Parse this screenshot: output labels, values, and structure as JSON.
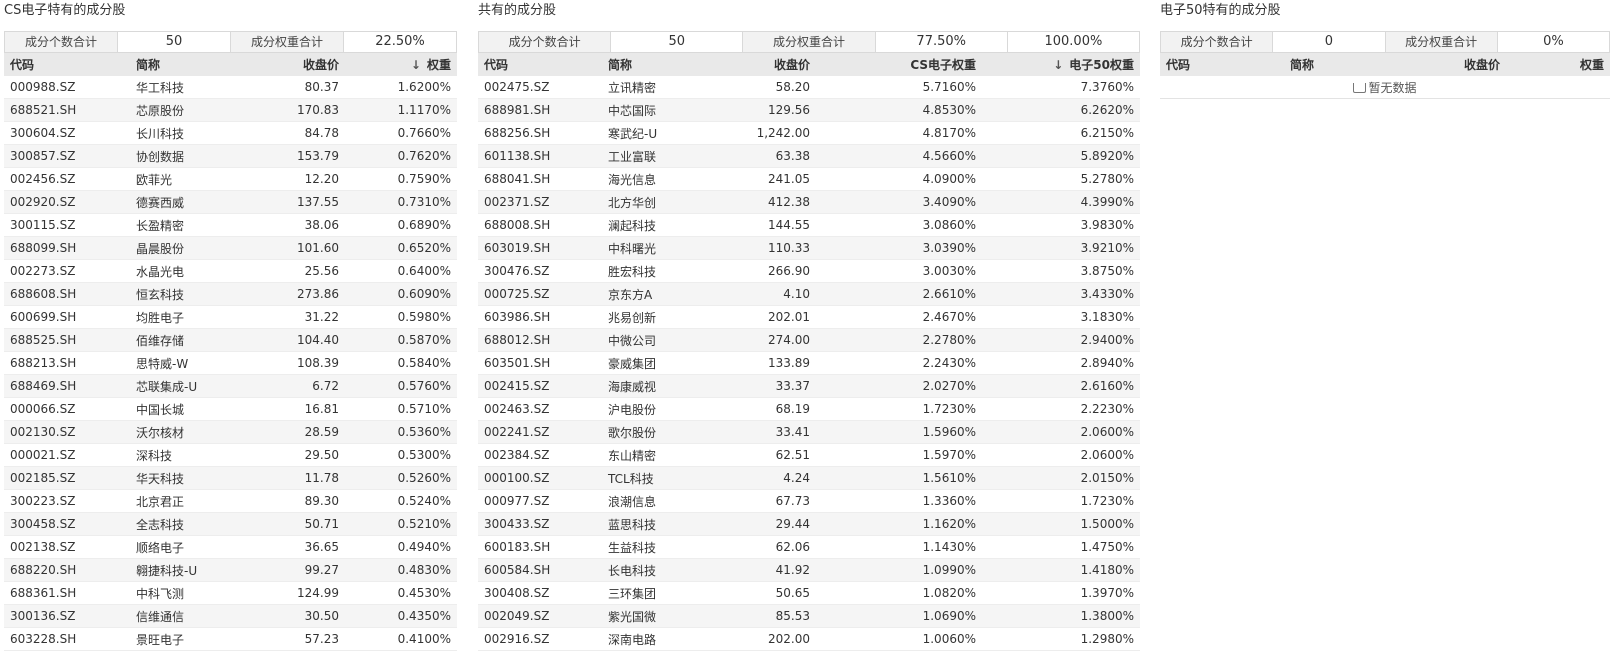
{
  "panel1": {
    "title": "CS电子特有的成分股",
    "summary": {
      "count_label": "成分个数合计",
      "count_value": "50",
      "weight_label": "成分权重合计",
      "weight_value": "22.50%"
    },
    "columns": [
      "代码",
      "简称",
      "收盘价",
      "权重"
    ],
    "sort_indicator": "↓",
    "rows": [
      [
        "000988.SZ",
        "华工科技",
        "80.37",
        "1.6200%"
      ],
      [
        "688521.SH",
        "芯原股份",
        "170.83",
        "1.1170%"
      ],
      [
        "300604.SZ",
        "长川科技",
        "84.78",
        "0.7660%"
      ],
      [
        "300857.SZ",
        "协创数据",
        "153.79",
        "0.7620%"
      ],
      [
        "002456.SZ",
        "欧菲光",
        "12.20",
        "0.7590%"
      ],
      [
        "002920.SZ",
        "德赛西威",
        "137.55",
        "0.7310%"
      ],
      [
        "300115.SZ",
        "长盈精密",
        "38.06",
        "0.6890%"
      ],
      [
        "688099.SH",
        "晶晨股份",
        "101.60",
        "0.6520%"
      ],
      [
        "002273.SZ",
        "水晶光电",
        "25.56",
        "0.6400%"
      ],
      [
        "688608.SH",
        "恒玄科技",
        "273.86",
        "0.6090%"
      ],
      [
        "600699.SH",
        "均胜电子",
        "31.22",
        "0.5980%"
      ],
      [
        "688525.SH",
        "佰维存储",
        "104.40",
        "0.5870%"
      ],
      [
        "688213.SH",
        "思特威-W",
        "108.39",
        "0.5840%"
      ],
      [
        "688469.SH",
        "芯联集成-U",
        "6.72",
        "0.5760%"
      ],
      [
        "000066.SZ",
        "中国长城",
        "16.81",
        "0.5710%"
      ],
      [
        "002130.SZ",
        "沃尔核材",
        "28.59",
        "0.5360%"
      ],
      [
        "000021.SZ",
        "深科技",
        "29.50",
        "0.5300%"
      ],
      [
        "002185.SZ",
        "华天科技",
        "11.78",
        "0.5260%"
      ],
      [
        "300223.SZ",
        "北京君正",
        "89.30",
        "0.5240%"
      ],
      [
        "300458.SZ",
        "全志科技",
        "50.71",
        "0.5210%"
      ],
      [
        "002138.SZ",
        "顺络电子",
        "36.65",
        "0.4940%"
      ],
      [
        "688220.SH",
        "翱捷科技-U",
        "99.27",
        "0.4830%"
      ],
      [
        "688361.SH",
        "中科飞测",
        "124.99",
        "0.4530%"
      ],
      [
        "300136.SZ",
        "信维通信",
        "30.50",
        "0.4350%"
      ],
      [
        "603228.SH",
        "景旺电子",
        "57.23",
        "0.4100%"
      ]
    ]
  },
  "panel2": {
    "title": "共有的成分股",
    "summary": {
      "count_label": "成分个数合计",
      "count_value": "50",
      "weight_label": "成分权重合计",
      "weight_value": "77.50%",
      "weight_value2": "100.00%"
    },
    "columns": [
      "代码",
      "简称",
      "收盘价",
      "CS电子权重",
      "电子50权重"
    ],
    "sort_indicator": "↓",
    "rows": [
      [
        "002475.SZ",
        "立讯精密",
        "58.20",
        "5.7160%",
        "7.3760%"
      ],
      [
        "688981.SH",
        "中芯国际",
        "129.56",
        "4.8530%",
        "6.2620%"
      ],
      [
        "688256.SH",
        "寒武纪-U",
        "1,242.00",
        "4.8170%",
        "6.2150%"
      ],
      [
        "601138.SH",
        "工业富联",
        "63.38",
        "4.5660%",
        "5.8920%"
      ],
      [
        "688041.SH",
        "海光信息",
        "241.05",
        "4.0900%",
        "5.2780%"
      ],
      [
        "002371.SZ",
        "北方华创",
        "412.38",
        "3.4090%",
        "4.3990%"
      ],
      [
        "688008.SH",
        "澜起科技",
        "144.55",
        "3.0860%",
        "3.9830%"
      ],
      [
        "603019.SH",
        "中科曙光",
        "110.33",
        "3.0390%",
        "3.9210%"
      ],
      [
        "300476.SZ",
        "胜宏科技",
        "266.90",
        "3.0030%",
        "3.8750%"
      ],
      [
        "000725.SZ",
        "京东方A",
        "4.10",
        "2.6610%",
        "3.4330%"
      ],
      [
        "603986.SH",
        "兆易创新",
        "202.01",
        "2.4670%",
        "3.1830%"
      ],
      [
        "688012.SH",
        "中微公司",
        "274.00",
        "2.2780%",
        "2.9400%"
      ],
      [
        "603501.SH",
        "豪威集团",
        "133.89",
        "2.2430%",
        "2.8940%"
      ],
      [
        "002415.SZ",
        "海康威视",
        "33.37",
        "2.0270%",
        "2.6160%"
      ],
      [
        "002463.SZ",
        "沪电股份",
        "68.19",
        "1.7230%",
        "2.2230%"
      ],
      [
        "002241.SZ",
        "歌尔股份",
        "33.41",
        "1.5960%",
        "2.0600%"
      ],
      [
        "002384.SZ",
        "东山精密",
        "62.51",
        "1.5970%",
        "2.0600%"
      ],
      [
        "000100.SZ",
        "TCL科技",
        "4.24",
        "1.5610%",
        "2.0150%"
      ],
      [
        "000977.SZ",
        "浪潮信息",
        "67.73",
        "1.3360%",
        "1.7230%"
      ],
      [
        "300433.SZ",
        "蓝思科技",
        "29.44",
        "1.1620%",
        "1.5000%"
      ],
      [
        "600183.SH",
        "生益科技",
        "62.06",
        "1.1430%",
        "1.4750%"
      ],
      [
        "600584.SH",
        "长电科技",
        "41.92",
        "1.0990%",
        "1.4180%"
      ],
      [
        "300408.SZ",
        "三环集团",
        "50.65",
        "1.0820%",
        "1.3970%"
      ],
      [
        "002049.SZ",
        "紫光国微",
        "85.53",
        "1.0690%",
        "1.3800%"
      ],
      [
        "002916.SZ",
        "深南电路",
        "202.00",
        "1.0060%",
        "1.2980%"
      ]
    ]
  },
  "panel3": {
    "title": "电子50特有的成分股",
    "summary": {
      "count_label": "成分个数合计",
      "count_value": "0",
      "weight_label": "成分权重合计",
      "weight_value": "0%"
    },
    "columns": [
      "代码",
      "简称",
      "收盘价",
      "权重"
    ],
    "empty_text": "暂无数据",
    "empty_icon": "inbox-icon"
  }
}
